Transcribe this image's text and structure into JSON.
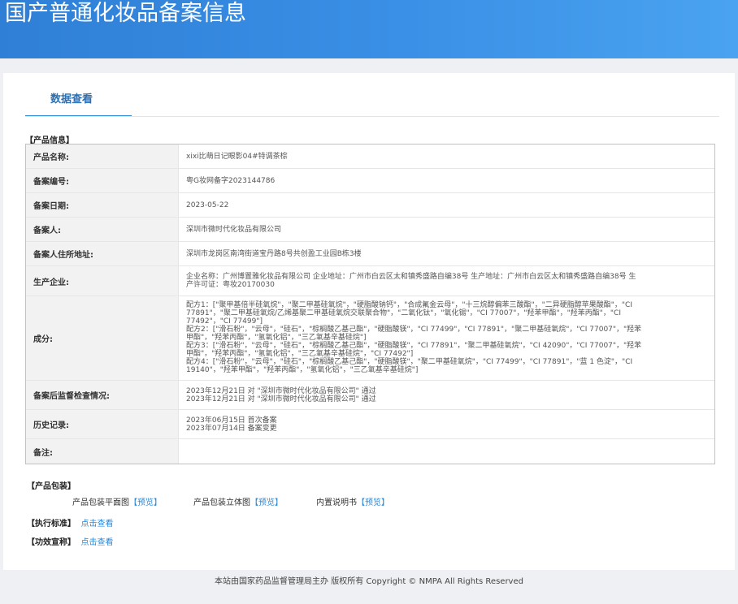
{
  "header": {
    "title": "国产普通化妆品备案信息"
  },
  "tabs": {
    "active": "数据查看"
  },
  "product_info": {
    "section_title": "【产品信息】",
    "name_label": "产品名称:",
    "name": "xixi比萌日记眼影04#特调茶棕",
    "code_label": "备案编号:",
    "code": "粤G妆网备字2023144786",
    "date_label": "备案日期:",
    "date": "2023-05-22",
    "filer_label": "备案人:",
    "filer": "深圳市微时代化妆品有限公司",
    "address_label": "备案人住所地址:",
    "address": "深圳市龙岗区南湾街道宝丹路8号共创盈工业园B栋3楼",
    "producer_label": "生产企业:",
    "producer_lines": [
      "企业名称：广州博置雅化妆品有限公司 企业地址：广州市白云区太和镇秀盛路自编38号 生产地址：广州市白云区太和镇秀盛路自编38号 生",
      "产许可证：粤妆20170030"
    ],
    "ingredients_label": "成分:",
    "ingredients_lines": [
      "配方1：[\"聚甲基倍半硅氧烷\"，\"聚二甲基硅氧烷\"，\"硬脂酸钠钙\"，\"合成氟金云母\"，\"十三烷醇偏苯三酸酯\"，\"二异硬脂醇苹果酸酯\"，\"CI",
      "77891\"，\"聚二甲基硅氧烷/乙烯基聚二甲基硅氧烷交联聚合物\"，\"二氧化钛\"，\"氧化锡\"，\"CI 77007\"，\"羟苯甲酯\"，\"羟苯丙酯\"，\"CI",
      "77492\"，\"CI 77499\"]",
      "配方2：[\"滑石粉\"，\"云母\"，\"硅石\"，\"棕榈酸乙基己酯\"，\"硬脂酸镁\"，\"CI 77499\"，\"CI 77891\"，\"聚二甲基硅氧烷\"，\"CI 77007\"，\"羟苯",
      "甲酯\"，\"羟苯丙酯\"，\"氢氧化铝\"，\"三乙氧基辛基硅烷\"]",
      "配方3：[\"滑石粉\"，\"云母\"，\"硅石\"，\"棕榈酸乙基己酯\"，\"硬脂酸镁\"，\"CI 77891\"，\"聚二甲基硅氧烷\"，\"CI 42090\"，\"CI 77007\"，\"羟苯",
      "甲酯\"，\"羟苯丙酯\"，\"氢氧化铝\"，\"三乙氧基辛基硅烷\"，\"CI 77492\"]",
      "配方4：[\"滑石粉\"，\"云母\"，\"硅石\"，\"棕榈酸乙基己酯\"，\"硬脂酸镁\"，\"聚二甲基硅氧烷\"，\"CI 77499\"，\"CI 77891\"，\"蓝 1 色淀\"，\"CI",
      "19140\"，\"羟苯甲酯\"，\"羟苯丙酯\"，\"氢氧化铝\"，\"三乙氧基辛基硅烷\"]"
    ],
    "inspection_label": "备案后监督检查情况:",
    "inspection_lines": [
      "2023年12月21日 对 \"深圳市微时代化妆品有限公司\" 通过",
      "2023年12月21日 对 \"深圳市微时代化妆品有限公司\" 通过"
    ],
    "history_label": "历史记录:",
    "history_lines": [
      "2023年06月15日 首次备案",
      "2023年07月14日 备案变更"
    ],
    "remark_label": "备注:",
    "remark": ""
  },
  "packaging": {
    "section_title": "【产品包装】",
    "flat_label": "产品包装平面图",
    "flat_link": "【预览】",
    "solid_label": "产品包装立体图",
    "solid_link": "【预览】",
    "manual_label": "内置说明书",
    "manual_link": "【预览】"
  },
  "standard": {
    "label": "【执行标准】",
    "link": "点击查看"
  },
  "efficacy": {
    "label": "【功效宣称】",
    "link": "点击查看"
  },
  "footer": {
    "text": "本站由国家药品监督管理局主办 版权所有 Copyright © NMPA All Rights Reserved"
  }
}
